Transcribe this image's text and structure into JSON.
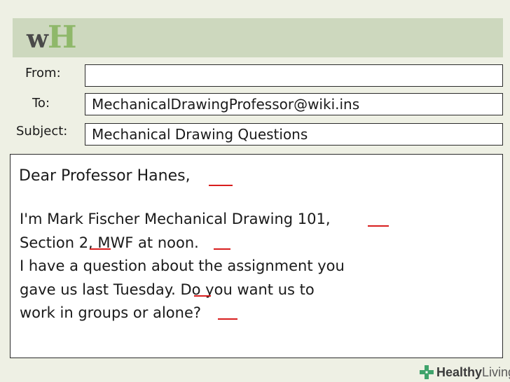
{
  "logo": {
    "w": "w",
    "h": "H"
  },
  "colors": {
    "header_bar": "#cdd8be",
    "logo_accent": "#8fb86a",
    "spelling_underline": "#d81e1e",
    "brand_green": "#3fa36b"
  },
  "email": {
    "from_label": "From:",
    "from_value": "",
    "to_label": "To:",
    "to_value": "MechanicalDrawingProfessor@wiki.ins",
    "subject_label": "Subject:",
    "subject_value": "Mechanical Drawing Questions"
  },
  "body": {
    "greeting": "Dear Professor Hanes,",
    "lines": [
      "I'm Mark Fischer Mechanical Drawing 101,",
      "Section 2, MWF at noon.",
      "I have a question about the assignment you",
      "gave us last Tuesday. Do you want us to",
      "work in groups or alone?"
    ]
  },
  "brand": {
    "part1": "Healthy",
    "part2": "Living",
    "icon": "medical-cross-icon"
  }
}
